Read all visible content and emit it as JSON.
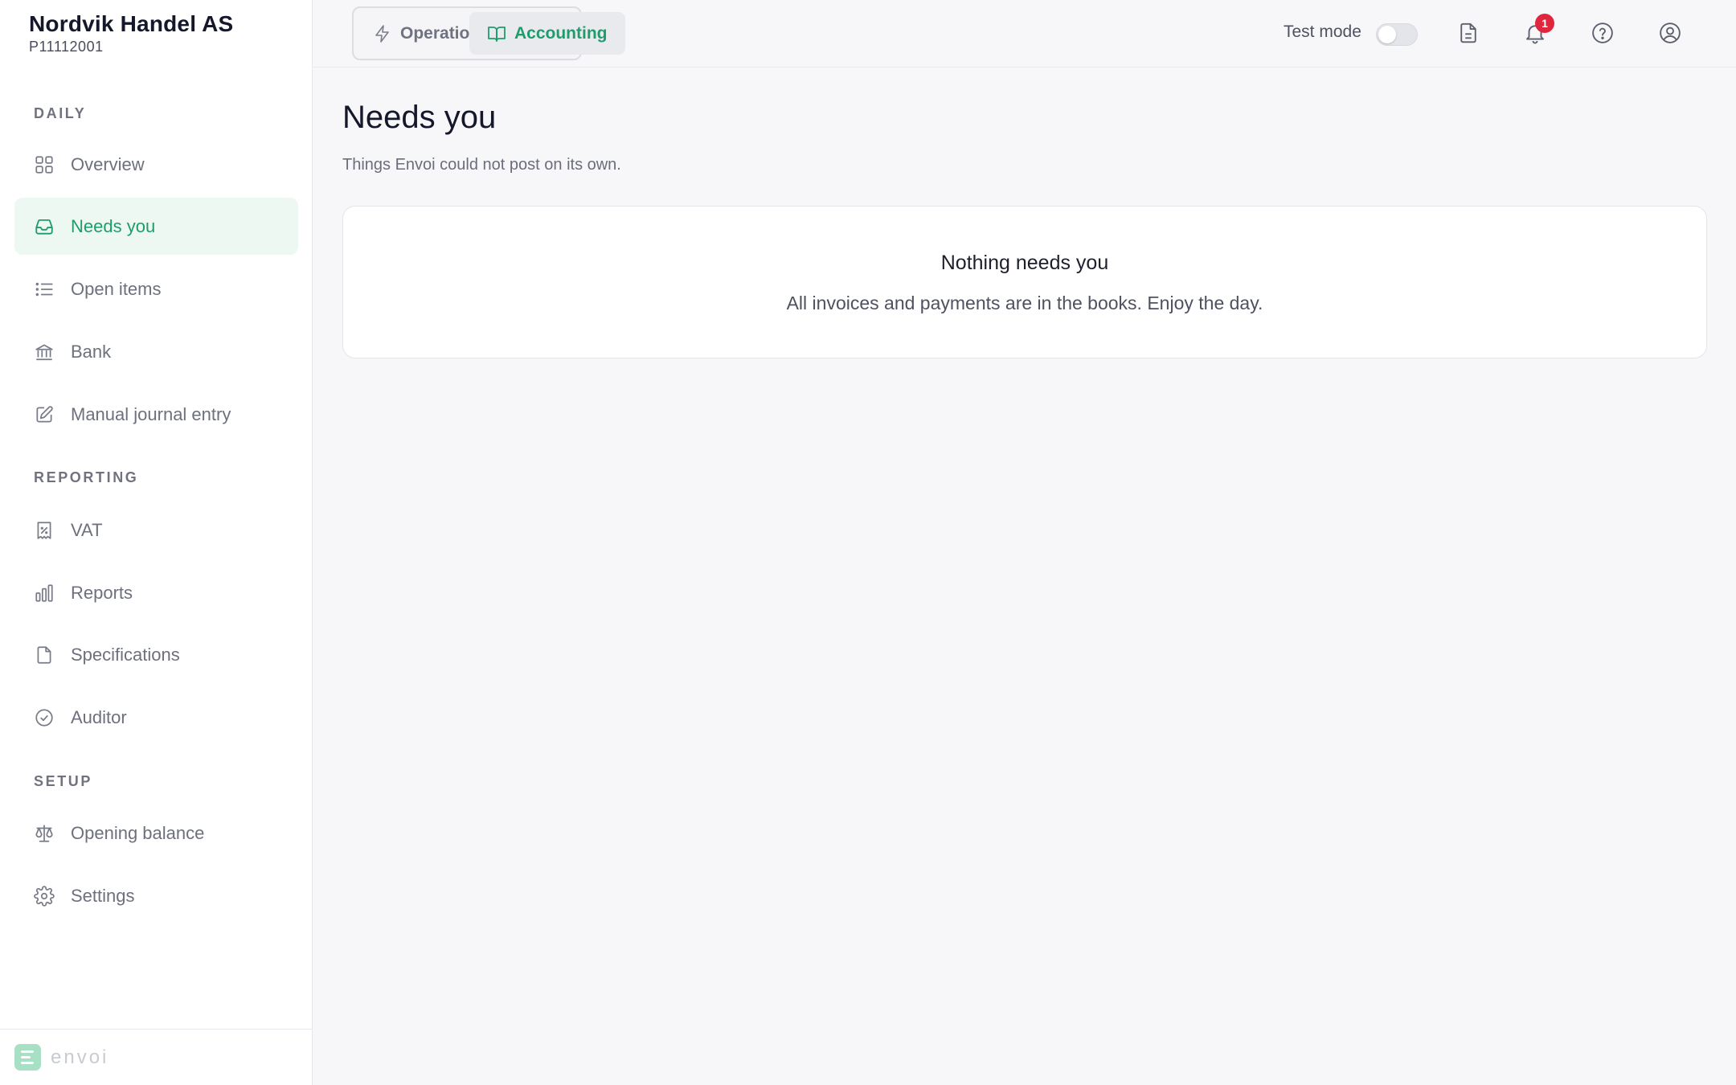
{
  "company": {
    "name": "Nordvik Handel AS",
    "id": "P11112001"
  },
  "sidebar": {
    "sections": {
      "daily": "DAILY",
      "reporting": "REPORTING",
      "setup": "SETUP"
    },
    "items": [
      {
        "label": "Overview",
        "icon": "grid-icon"
      },
      {
        "label": "Needs you",
        "icon": "inbox-icon",
        "active": true
      },
      {
        "label": "Open items",
        "icon": "list-icon"
      },
      {
        "label": "Bank",
        "icon": "bank-icon"
      },
      {
        "label": "Manual journal entry",
        "icon": "pencil-square-icon"
      },
      {
        "label": "VAT",
        "icon": "receipt-percent-icon"
      },
      {
        "label": "Reports",
        "icon": "bar-chart-icon"
      },
      {
        "label": "Specifications",
        "icon": "file-icon"
      },
      {
        "label": "Auditor",
        "icon": "check-circle-icon"
      },
      {
        "label": "Opening balance",
        "icon": "scale-icon"
      },
      {
        "label": "Settings",
        "icon": "gear-icon"
      }
    ],
    "footer_logo": "envoi"
  },
  "topbar": {
    "tabs": [
      {
        "label": "Operations",
        "icon": "lightning-icon"
      },
      {
        "label": "Accounting",
        "icon": "book-open-icon",
        "active": true
      }
    ],
    "test_mode_label": "Test mode",
    "test_mode_on": false,
    "notification_count": "1"
  },
  "main": {
    "title": "Needs you",
    "subtitle": "Things Envoi could not post on its own.",
    "empty_state": {
      "title": "Nothing needs you",
      "text": "All invoices and payments are in the books. Enjoy the day."
    }
  },
  "colors": {
    "accent": "#1f9c6b",
    "active_bg": "#edf8f3",
    "badge": "#e0263d"
  }
}
